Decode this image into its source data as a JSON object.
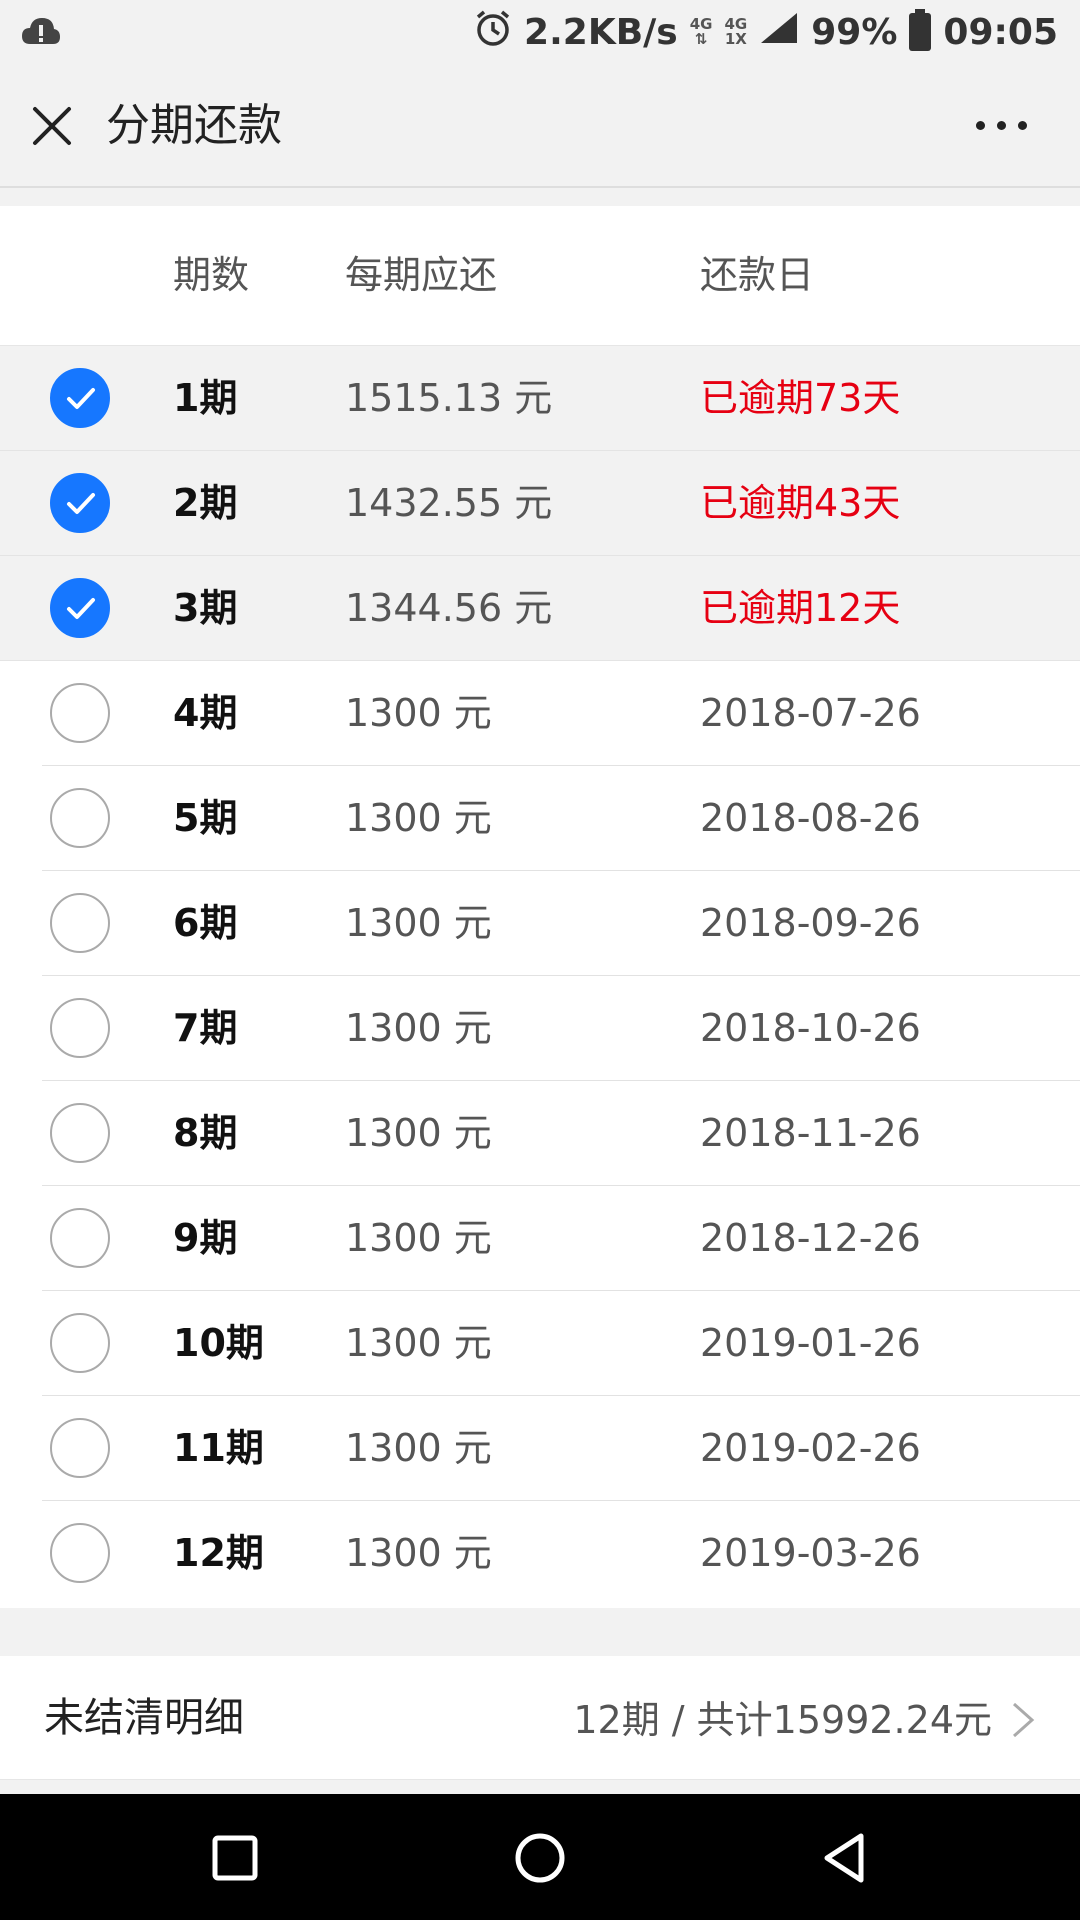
{
  "status_bar": {
    "net_speed": "2.2KB/s",
    "net_type_1": "4G",
    "net_type_2": "4G",
    "net_type_2_sub": "1X",
    "battery": "99%",
    "time": "09:05"
  },
  "nav": {
    "title": "分期还款"
  },
  "table": {
    "headers": {
      "period": "期数",
      "amount": "每期应还",
      "date": "还款日"
    },
    "rows": [
      {
        "period": "1期",
        "amount": "1515.13 元",
        "date": "已逾期73天",
        "selected": true,
        "overdue": true
      },
      {
        "period": "2期",
        "amount": "1432.55 元",
        "date": "已逾期43天",
        "selected": true,
        "overdue": true
      },
      {
        "period": "3期",
        "amount": "1344.56 元",
        "date": "已逾期12天",
        "selected": true,
        "overdue": true
      },
      {
        "period": "4期",
        "amount": "1300 元",
        "date": "2018-07-26",
        "selected": false,
        "overdue": false
      },
      {
        "period": "5期",
        "amount": "1300 元",
        "date": "2018-08-26",
        "selected": false,
        "overdue": false
      },
      {
        "period": "6期",
        "amount": "1300 元",
        "date": "2018-09-26",
        "selected": false,
        "overdue": false
      },
      {
        "period": "7期",
        "amount": "1300 元",
        "date": "2018-10-26",
        "selected": false,
        "overdue": false
      },
      {
        "period": "8期",
        "amount": "1300 元",
        "date": "2018-11-26",
        "selected": false,
        "overdue": false
      },
      {
        "period": "9期",
        "amount": "1300 元",
        "date": "2018-12-26",
        "selected": false,
        "overdue": false
      },
      {
        "period": "10期",
        "amount": "1300 元",
        "date": "2019-01-26",
        "selected": false,
        "overdue": false
      },
      {
        "period": "11期",
        "amount": "1300 元",
        "date": "2019-02-26",
        "selected": false,
        "overdue": false
      },
      {
        "period": "12期",
        "amount": "1300 元",
        "date": "2019-03-26",
        "selected": false,
        "overdue": false
      }
    ]
  },
  "summary": {
    "label": "未结清明细",
    "value": "12期 / 共计15992.24元"
  },
  "colors": {
    "accent": "#1677ff",
    "overdue": "#e60012"
  },
  "icons": {
    "status_left": "cloud-alert-icon",
    "alarm": "alarm-clock-icon",
    "signal": "signal-icon",
    "battery": "battery-icon",
    "close": "close-icon",
    "more": "more-dots-icon",
    "check": "checkmark-icon",
    "chevron": "chevron-right-icon",
    "recent": "recent-apps-icon",
    "home": "home-icon",
    "back": "back-icon"
  }
}
